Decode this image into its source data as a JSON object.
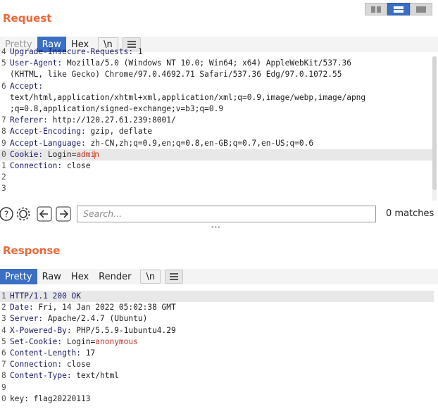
{
  "request": {
    "title": "Request",
    "tabs": [
      "Pretty",
      "Raw",
      "Hex",
      "\\n"
    ],
    "lines": [
      {
        "n": "4",
        "key": "Upgrade-Insecure-Requests:",
        "val": " 1"
      },
      {
        "n": "5",
        "key": "User-Agent:",
        "val": " Mozilla/5.0 (Windows NT 10.0; Win64; x64) AppleWebKit/537.36"
      },
      {
        "n": "",
        "key": "",
        "val": "(KHTML, like Gecko) Chrome/97.0.4692.71 Safari/537.36 Edg/97.0.1072.55"
      },
      {
        "n": "6",
        "key": "Accept:",
        "val": ""
      },
      {
        "n": "",
        "key": "",
        "val": "text/html,application/xhtml+xml,application/xml;q=0.9,image/webp,image/apng"
      },
      {
        "n": "",
        "key": "",
        "val": ";q=0.8,application/signed-exchange;v=b3;q=0.9"
      },
      {
        "n": "7",
        "key": "Referer:",
        "val": " http://120.27.61.239:8001/"
      },
      {
        "n": "8",
        "key": "Accept-Encoding:",
        "val": " gzip, deflate"
      },
      {
        "n": "9",
        "key": "Accept-Language:",
        "val": " zh-CN,zh;q=0.9,en;q=0.8,en-GB;q=0.7,en-US;q=0.6"
      },
      {
        "n": "0",
        "key": "Cookie:",
        "val": " Login=",
        "cookie": "admin"
      },
      {
        "n": "1",
        "key": "Connection:",
        "val": " close"
      },
      {
        "n": "2",
        "key": "",
        "val": ""
      },
      {
        "n": "3",
        "key": "",
        "val": ""
      }
    ]
  },
  "search": {
    "placeholder": "Search...",
    "matches": "0 matches"
  },
  "response": {
    "title": "Response",
    "tabs": [
      "Pretty",
      "Raw",
      "Hex",
      "Render",
      "\\n"
    ],
    "lines": [
      {
        "n": "1",
        "key": "HTTP/1.1 200 OK",
        "val": ""
      },
      {
        "n": "2",
        "key": "Date:",
        "val": " Fri, 14 Jan 2022 05:02:38 GMT"
      },
      {
        "n": "3",
        "key": "Server:",
        "val": " Apache/2.4.7 (Ubuntu)"
      },
      {
        "n": "4",
        "key": "X-Powered-By:",
        "val": " PHP/5.5.9-1ubuntu4.29"
      },
      {
        "n": "5",
        "key": "Set-Cookie:",
        "val": " Login=",
        "cookie": "anonymous"
      },
      {
        "n": "6",
        "key": "Content-Length:",
        "val": " 17"
      },
      {
        "n": "7",
        "key": "Connection:",
        "val": " close"
      },
      {
        "n": "8",
        "key": "Content-Type:",
        "val": " text/html"
      },
      {
        "n": "9",
        "key": "",
        "val": ""
      },
      {
        "n": "0",
        "key": "",
        "val": "key: flag20220113"
      }
    ]
  },
  "colors": {
    "accent": "#e8693a",
    "tab_active": "#3a6fc4",
    "cookie_value": "#c5352a"
  }
}
